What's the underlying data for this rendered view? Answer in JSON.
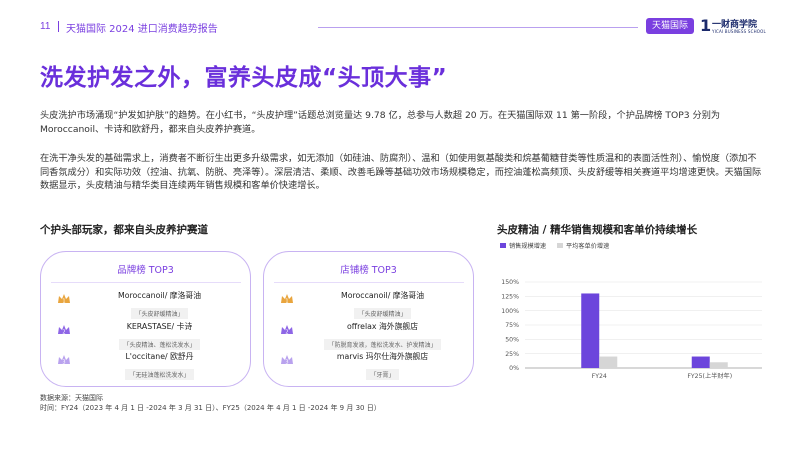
{
  "header": {
    "page_number": "11",
    "report_title": "天猫国际 2024 进口消费趋势报告",
    "tmall_badge": "天猫国际",
    "partner_mark": "1",
    "partner_name": "一财商学院",
    "partner_sub": "YICAI BUSINESS SCHOOL"
  },
  "title": "洗发护发之外，富养头皮成“头顶大事”",
  "paragraphs": [
    "头皮洗护市场涌现“护发如护肤”的趋势。在小红书，“头皮护理”话题总浏览量达 9.78 亿，总参与人数超 20 万。在天猫国际双 11 第一阶段，个护品牌榜 TOP3 分别为 Moroccanoil、卡诗和欧舒丹，都来自头皮养护赛道。",
    "在洗干净头发的基础需求上，消费者不断衍生出更多升级需求，如无添加（如硅油、防腐剂）、温和（如使用氨基酸类和烷基葡糖苷类等性质温和的表面活性剂）、愉悦度（添加不同香氛成分）和实际功效（控油、抗氧、防脱、亮泽等）。深层清洁、柔顺、改善毛躁等基础功效市场规模稳定，而控油蓬松高频顶、头皮舒缓等相关赛道平均增速更快。天猫国际数据显示，头皮精油与精华类目连续两年销售规模和客单价快速增长。"
  ],
  "left_section": {
    "title": "个护头部玩家，都来自头皮养护赛道",
    "brand_card": {
      "title": "品牌榜 TOP3",
      "items": [
        {
          "rank": "1",
          "name": "Moroccanoil/ 摩洛哥油",
          "tag": "「头皮舒缓精油」"
        },
        {
          "rank": "2",
          "name": "KERASTASE/ 卡诗",
          "tag": "「头皮精油、蓬松洗发水」"
        },
        {
          "rank": "3",
          "name": "L'occitane/ 欧舒丹",
          "tag": "「无硅油蓬松洗发水」"
        }
      ]
    },
    "store_card": {
      "title": "店铺榜 TOP3",
      "items": [
        {
          "rank": "1",
          "name": "Moroccanoil/ 摩洛哥油",
          "tag": "「头皮舒缓精油」"
        },
        {
          "rank": "2",
          "name": "offrelax 海外旗舰店",
          "tag": "「防脱育发液，蓬松洗发水、护发精油」"
        },
        {
          "rank": "3",
          "name": "marvis 玛尔仕海外旗舰店",
          "tag": "「牙膏」"
        }
      ]
    }
  },
  "right_section": {
    "title": "头皮精油 / 精华销售规模和客单价持续增长"
  },
  "colors": {
    "accent": "#6a2fdb",
    "bar_primary": "#6c45dc",
    "bar_secondary": "#d6d6d6",
    "crown_gold": "#e9a53e",
    "crown_purple": "#9c7ee8"
  },
  "chart_data": {
    "type": "bar",
    "categories": [
      "FY24",
      "FY25(上半财年)"
    ],
    "series": [
      {
        "name": "销售规模增速",
        "values": [
          130,
          20
        ]
      },
      {
        "name": "平均客单价增速",
        "values": [
          20,
          10
        ]
      }
    ],
    "y_ticks": [
      "0%",
      "25%",
      "50%",
      "75%",
      "100%",
      "125%",
      "150%"
    ],
    "ylim": [
      0,
      150
    ],
    "legend": "top-left",
    "grid": true
  },
  "footer": {
    "source": "数据来源：天猫国际",
    "period": "时间：FY24（2023 年 4 月 1 日 -2024 年 3 月 31 日）、FY25（2024 年 4 月 1 日 -2024 年 9 月 30 日）"
  }
}
